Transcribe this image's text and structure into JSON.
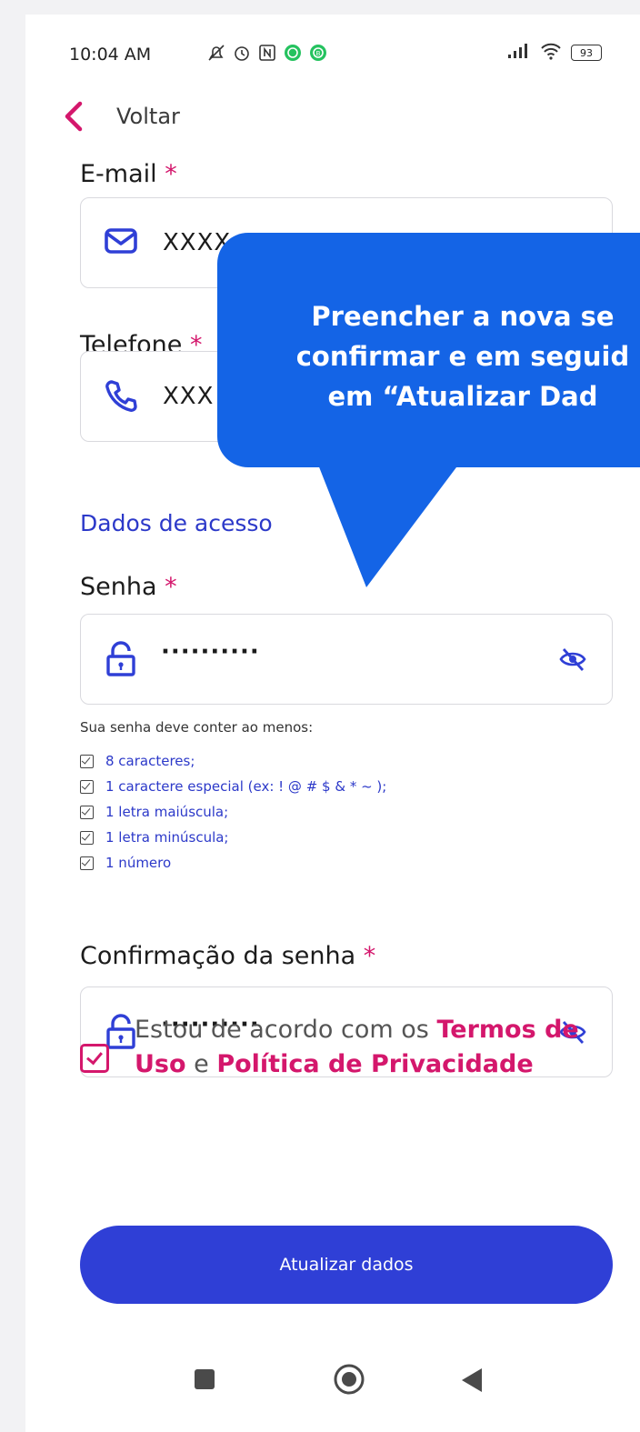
{
  "status_bar": {
    "time": "10:04 AM",
    "battery": "93",
    "icons": [
      "notifications-off-icon",
      "alarm-icon",
      "nfc-icon",
      "whatsapp-icon",
      "whatsapp-business-icon",
      "signal-icon",
      "wifi-icon",
      "battery-icon"
    ]
  },
  "header": {
    "back_label": "Voltar"
  },
  "email": {
    "label": "E-mail",
    "required": "*",
    "value": "XXXX"
  },
  "phone": {
    "label": "Telefone",
    "required": "*",
    "value": "XXX"
  },
  "access": {
    "title": "Dados de acesso",
    "password": {
      "label": "Senha",
      "required": "*",
      "value": "··········"
    },
    "hint": "Sua senha deve conter ao menos:",
    "rules": [
      "8 caracteres;",
      "1 caractere especial (ex: ! @ # $ & * ~ );",
      "1 letra maiúscula;",
      "1 letra minúscula;",
      "1 número"
    ],
    "confirm": {
      "label": "Confirmação da senha",
      "required": "*",
      "value": "··········"
    }
  },
  "terms": {
    "prefix": "Estou de acordo com os ",
    "terms_link": "Termos de Uso",
    "connector": " e ",
    "privacy_link": "Política de Privacidade",
    "checked": true
  },
  "submit_label": "Atualizar dados",
  "tooltip": {
    "text": "Preencher a nova se\nconfirmar e em seguid\nem “Atualizar Dad"
  },
  "colors": {
    "primary": "#2f3fd6",
    "accent": "#d4176c",
    "tooltip": "#1464e6"
  }
}
